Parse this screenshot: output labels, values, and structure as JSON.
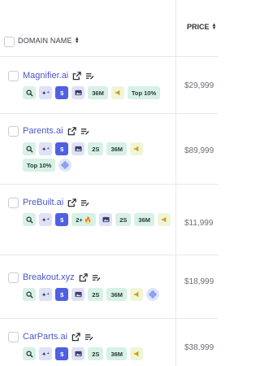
{
  "header": {
    "domain_label": "DOMAIN NAME",
    "price_label": "PRICE"
  },
  "rows": [
    {
      "name": "Magnifier.ai",
      "price": "$29,999",
      "badges": [
        "",
        "",
        "",
        "",
        "36M",
        "",
        "Top 10%"
      ]
    },
    {
      "name": "Parents.ai",
      "price": "$89,999",
      "badges": [
        "",
        "",
        "",
        "",
        "2S",
        "36M",
        "",
        "Top 10%",
        ""
      ]
    },
    {
      "name": "PreBuilt.ai",
      "price": "$11,999",
      "badges": [
        "",
        "",
        "",
        "2+ 🔥",
        "",
        "2S",
        "36M",
        ""
      ]
    },
    {
      "name": "Breakout.xyz",
      "price": "$18,999",
      "badges": [
        "",
        "",
        "",
        "",
        "2S",
        "36M",
        "",
        ""
      ]
    },
    {
      "name": "CarParts.ai",
      "price": "$38,999",
      "badges": [
        "",
        "",
        "",
        "",
        "2S",
        "36M",
        ""
      ]
    }
  ],
  "colors": {
    "link": "#4b57c8",
    "accent_blue": "#4f60e0",
    "green_badge": "#d7f1e6",
    "lavender_badge": "#dfe1f6",
    "yellow_badge": "#eef6d7"
  }
}
